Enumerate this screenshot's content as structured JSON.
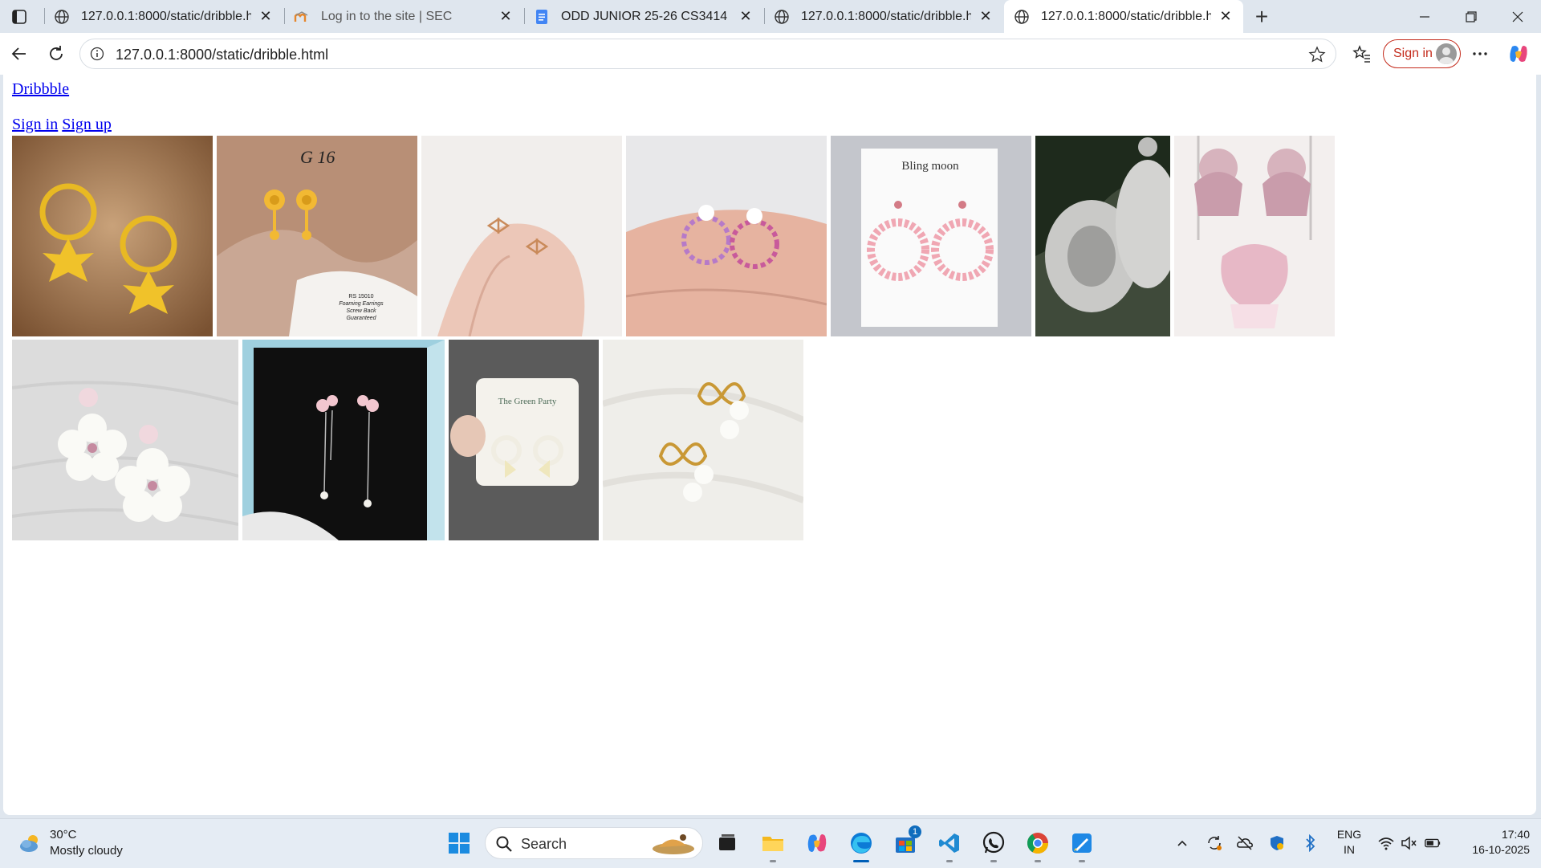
{
  "browser": {
    "tabs": [
      {
        "title": "127.0.0.1:8000/static/dribble.html",
        "icon": "globe-icon",
        "active": false
      },
      {
        "title": "Log in to the site | SEC",
        "icon": "moodle-icon",
        "active": false
      },
      {
        "title": "ODD JUNIOR 25-26 CS3414 - FW...",
        "icon": "google-docs-icon",
        "active": false
      },
      {
        "title": "127.0.0.1:8000/static/dribble.html",
        "icon": "globe-icon",
        "active": false
      },
      {
        "title": "127.0.0.1:8000/static/dribble.html",
        "icon": "globe-icon",
        "active": true
      }
    ],
    "address": "127.0.0.1:8000/static/dribble.html",
    "signin_label": "Sign in"
  },
  "page": {
    "logo_link": "Dribbble",
    "signin_link": "Sign in",
    "signup_link": "Sign up",
    "gallery": [
      {
        "name": "gold-flower-hoop-earrings",
        "caption": ""
      },
      {
        "name": "gold-rose-stud-earrings",
        "caption": "G 16",
        "card_text": [
          "RS 15010",
          "Foaming Earrings",
          "Screw Back",
          "Guaranteed"
        ]
      },
      {
        "name": "rose-gold-bow-studs",
        "caption": ""
      },
      {
        "name": "flower-wreath-earrings",
        "caption": ""
      },
      {
        "name": "bling-moon-pink-hoops",
        "caption": "Bling moon"
      },
      {
        "name": "silver-chandbali-earrings",
        "caption": ""
      },
      {
        "name": "pink-jhumka-set",
        "caption": ""
      },
      {
        "name": "white-flower-drop-earrings",
        "caption": ""
      },
      {
        "name": "flower-tassel-earrings-in-box",
        "caption": ""
      },
      {
        "name": "green-party-bow-wreath-earrings",
        "caption": "The Green Party"
      },
      {
        "name": "gold-bow-pearl-earrings",
        "caption": ""
      }
    ]
  },
  "taskbar": {
    "weather_temp": "30°C",
    "weather_desc": "Mostly cloudy",
    "search_label": "Search",
    "store_badge": "1",
    "language_line1": "ENG",
    "language_line2": "IN",
    "time": "17:40",
    "date": "16-10-2025"
  }
}
